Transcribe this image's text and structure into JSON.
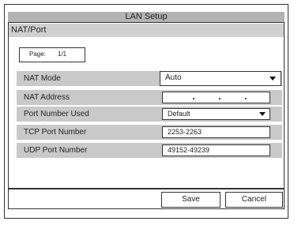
{
  "window": {
    "title": "LAN Setup"
  },
  "section": {
    "title": "NAT/Port"
  },
  "page": {
    "label": "Page:",
    "value": "1/1"
  },
  "fields": {
    "nat_mode": {
      "label": "NAT Mode",
      "value": "Auto",
      "icon": "chevron-down-icon"
    },
    "nat_address": {
      "label": "NAT Address",
      "value": ". . ."
    },
    "port_number_used": {
      "label": "Port Number Used",
      "value": "Default",
      "icon": "chevron-down-icon"
    },
    "tcp_port_number": {
      "label": "TCP Port Number",
      "value": "2253-2263"
    },
    "udp_port_number": {
      "label": "UDP Port Number",
      "value": "49152-49239"
    }
  },
  "buttons": {
    "save": "Save",
    "cancel": "Cancel"
  }
}
